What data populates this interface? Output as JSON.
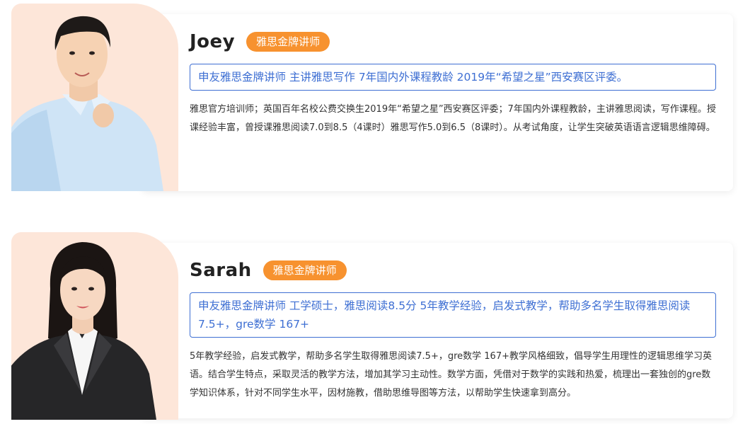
{
  "teachers": [
    {
      "name": "Joey",
      "badge": "雅思金牌讲师",
      "summary": "申友雅思金牌讲师 主讲雅思写作 7年国内外课程教龄 2019年“希望之星”西安赛区评委。",
      "bio": "雅思官方培训师；英国百年名校公费交换生2019年“希望之星”西安赛区评委；7年国内外课程教龄，主讲雅思阅读，写作课程。授课经验丰富，曾授课雅思阅读7.0到8.5（4课时）雅思写作5.0到6.5（8课时）。从考试角度，让学生突破英语语言逻辑思维障碍。"
    },
    {
      "name": "Sarah",
      "badge": "雅思金牌讲师",
      "summary": "申友雅思金牌讲师 工学硕士，雅思阅读8.5分 5年教学经验，启发式教学，帮助多名学生取得雅思阅读7.5+，gre数学 167+",
      "bio": "5年教学经验，启发式教学，帮助多名学生取得雅思阅读7.5+，gre数学 167+教学风格细致，倡导学生用理性的逻辑思维学习英语。结合学生特点，采取灵活的教学方法，增加其学习主动性。数学方面，凭借对于数学的实践和热爱，梳理出一套独创的gre数学知识体系，针对不同学生水平，因材施教，借助思维导图等方法，以帮助学生快速拿到高分。"
    }
  ],
  "colors": {
    "badge": "#f7922f",
    "summary": "#3e6fd3",
    "photo_bg": "#fde6d9"
  }
}
